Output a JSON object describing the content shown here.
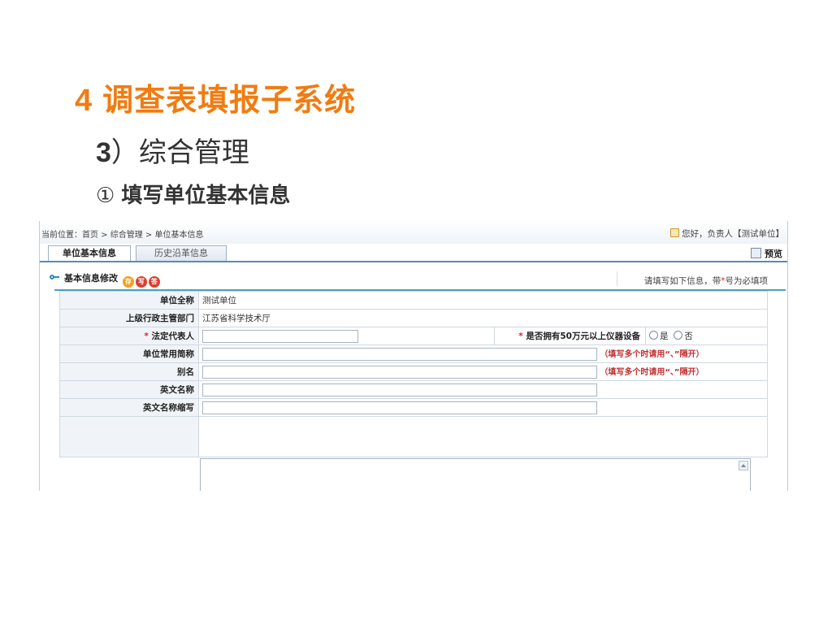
{
  "slide": {
    "title_num": "4",
    "title": "调查表填报子系统",
    "subtitle_num": "3",
    "subtitle": "）综合管理",
    "step_mark": "①",
    "step": "填写单位基本信息"
  },
  "app": {
    "breadcrumb": "当前位置：首页 > 综合管理 > 单位基本信息",
    "welcome": "您好，负责人【测试单位】",
    "tabs": [
      {
        "label": "单位基本信息",
        "active": true
      },
      {
        "label": "历史沿革信息",
        "active": false
      }
    ],
    "preview_label": "预览",
    "section_title": "基本信息修改",
    "action_buttons": [
      {
        "label": "存",
        "color": "#f0a020"
      },
      {
        "label": "写",
        "color": "#d84030"
      },
      {
        "label": "答",
        "color": "#d84030"
      }
    ],
    "instruction_prefix": "请填写如下信息，带",
    "instruction_star": "*",
    "instruction_suffix": "号为必填项",
    "form": {
      "full_name_label": "单位全称",
      "full_name_value": "测试单位",
      "dept_label": "上级行政主管部门",
      "dept_value": "江苏省科学技术厅",
      "legal_rep_star": "*",
      "legal_rep_label": "法定代表人",
      "legal_rep_value": "",
      "equip_star": "*",
      "equip_label": "是否拥有50万元以上仪器设备",
      "equip_yes": "是",
      "equip_no": "否",
      "short_name_label": "单位常用简称",
      "short_name_value": "",
      "short_name_hint": "（填写多个时请用“、”隔开）",
      "alias_label": "别名",
      "alias_value": "",
      "alias_hint": "（填写多个时请用“、”隔开）",
      "en_name_label": "英文名称",
      "en_name_value": "",
      "en_abbr_label": "英文名称缩写",
      "en_abbr_value": ""
    }
  }
}
